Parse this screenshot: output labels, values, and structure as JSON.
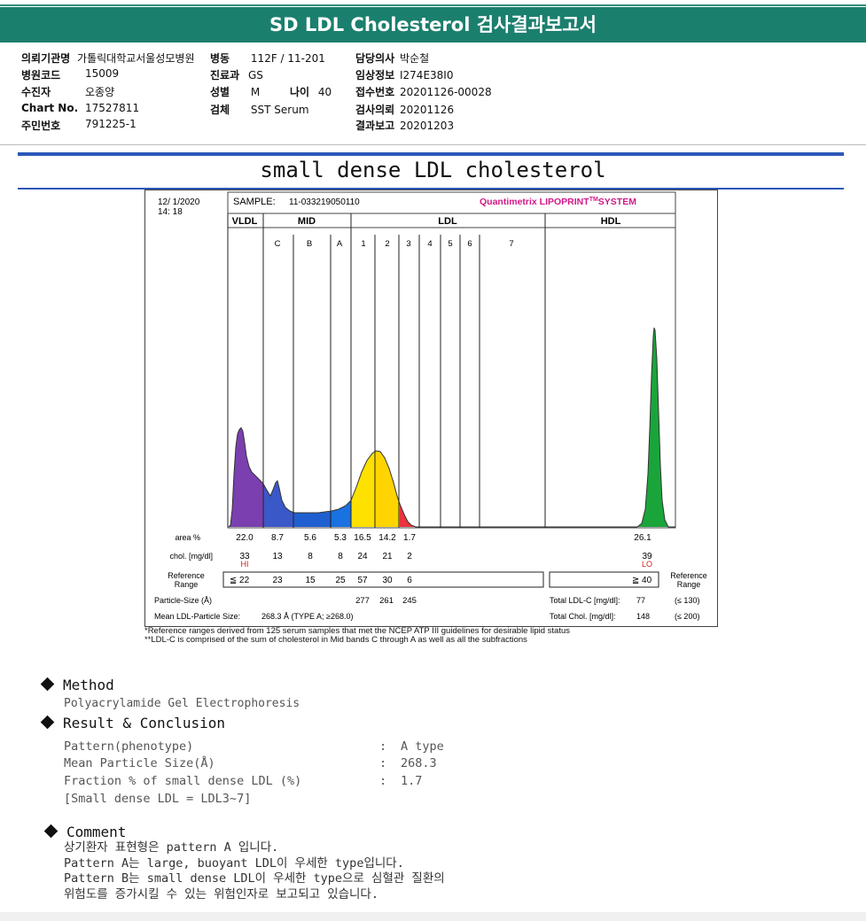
{
  "header": {
    "title": "SD LDL Cholesterol 검사결과보고서",
    "fields": {
      "institution_label": "의뢰기관명",
      "institution": "가톨릭대학교서울성모병원",
      "ward_label": "병동",
      "ward": "112F / 11-201",
      "doctor_label": "담당의사",
      "doctor": "박순철",
      "hospital_code_label": "병원코드",
      "hospital_code": "15009",
      "dept_label": "진료과",
      "dept": "GS",
      "clinical_label": "임상정보",
      "clinical": "I274E38I0",
      "patient_label": "수진자",
      "patient": "오종양",
      "sex_label": "성별",
      "sex": "M",
      "age_label": "나이",
      "age": "40",
      "receipt_label": "접수번호",
      "receipt": "20201126-00028",
      "chart_label": "Chart No.",
      "chart": "17527811",
      "specimen_label": "검체",
      "specimen": "SST Serum",
      "request_label": "검사의뢰",
      "request": "20201126",
      "id_label": "주민번호",
      "id": "791225-1",
      "report_label": "결과보고",
      "report": "20201203"
    }
  },
  "section_title": "small dense LDL cholesterol",
  "lipoprint": {
    "date": "12/ 1/2020",
    "time": "14: 18",
    "sample_label": "SAMPLE:",
    "sample": "11-033219050110",
    "brand": "Quantimetrix LIPOPRINT",
    "brand_tm": "TM",
    "brand_suffix": "SYSTEM",
    "groups": [
      "VLDL",
      "MID",
      "LDL",
      "HDL"
    ],
    "mid_bands": [
      "C",
      "B",
      "A"
    ],
    "ldl_bands": [
      "1",
      "2",
      "3",
      "4",
      "5",
      "6",
      "7"
    ],
    "area_label": "area %",
    "chol_label": "chol. [mg/dl]",
    "ref_label_1": "Reference",
    "ref_label_2": "Range",
    "area": [
      "22.0",
      "8.7",
      "5.6",
      "5.3",
      "16.5",
      "14.2",
      "1.7"
    ],
    "area_hdl": "26.1",
    "chol": [
      "33",
      "13",
      "8",
      "8",
      "24",
      "21",
      "2"
    ],
    "chol_hdl": "39",
    "flag_hi": "HI",
    "flag_lo": "LO",
    "ref_values": [
      "≦ 22",
      "23",
      "15",
      "25",
      "57",
      "30",
      "6"
    ],
    "ref_hdl": "≧ 40",
    "particle_size_label": "Particle-Size (Å)",
    "particle_sizes": [
      "277",
      "261",
      "245"
    ],
    "mean_size_label": "Mean LDL-Particle Size:",
    "mean_size": "268.3 Å  (TYPE A; ≥268.0)",
    "total_ldl_label": "Total LDL-C [mg/dl]:",
    "total_ldl": "77",
    "total_ldl_ref": "(≤ 130)",
    "total_chol_label": "Total Chol. [mg/dl]:",
    "total_chol": "148",
    "total_chol_ref": "(≤ 200)",
    "footnote_1": "*Reference ranges derived from 125 serum samples that met the NCEP ATP III guidelines for desirable lipid status",
    "footnote_2": "**LDL-C is comprised of the sum of cholesterol in Mid bands C through A as well as all the subfractions"
  },
  "colors": {
    "title_bg": "#1b7f6e",
    "vldl": "#7b3fb0",
    "mid": "#1f5fd0",
    "ldl1": "#ffe100",
    "ldl3": "#e8343c",
    "hdl": "#1aa53a",
    "brand": "#d01888",
    "flag": "#d32020"
  },
  "method": {
    "heading": "Method",
    "text": "Polyacrylamide Gel Electrophoresis"
  },
  "result": {
    "heading": "Result & Conclusion",
    "rows": [
      {
        "label": "Pattern(phenotype)",
        "value": "A type"
      },
      {
        "label": "Mean Particle Size(Å)",
        "value": "268.3"
      },
      {
        "label": "Fraction % of small dense LDL (%)",
        "value": "1.7"
      }
    ],
    "note": "[Small dense LDL = LDL3~7]"
  },
  "comment": {
    "heading": "Comment",
    "lines": [
      "상기환자 표현형은 pattern A 입니다.",
      "Pattern A는 large, buoyant LDL이 우세한 type입니다.",
      "Pattern B는 small dense LDL이 우세한 type으로 심혈관 질환의",
      "위험도를 증가시킬 수 있는 위험인자로 보고되고 있습니다."
    ]
  }
}
